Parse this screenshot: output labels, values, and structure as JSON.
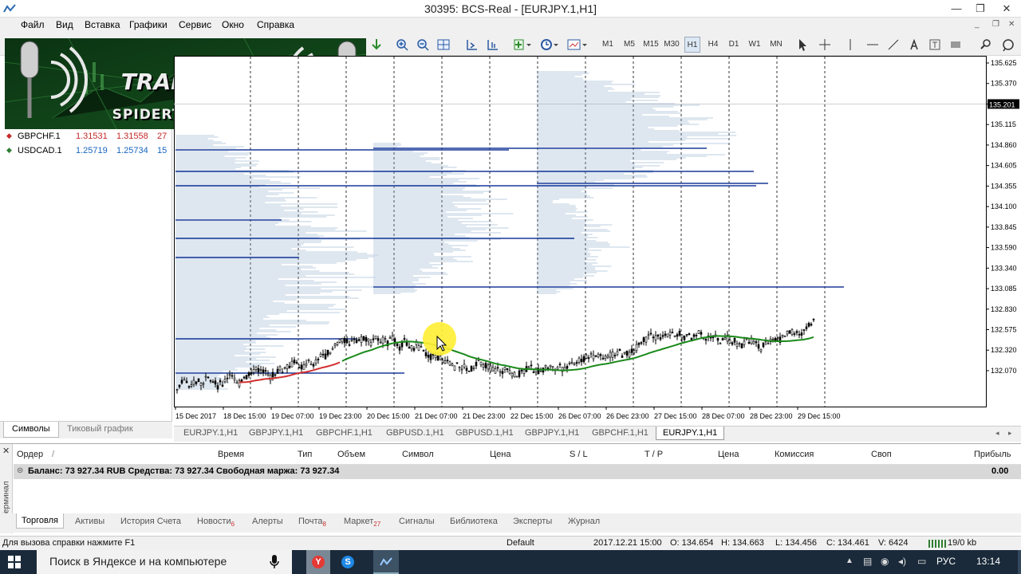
{
  "window": {
    "title": "30395: BCS-Real - [EURJPY.1,H1]"
  },
  "menu": [
    "Файл",
    "Вид",
    "Вставка",
    "Графики",
    "Сервис",
    "Окно",
    "Справка"
  ],
  "toolbar": {
    "timeframes": [
      "M1",
      "M5",
      "M15",
      "M30",
      "H1",
      "H4",
      "D1",
      "W1",
      "MN"
    ]
  },
  "banner": {
    "title": "TRADE FM",
    "subtitle": "SPIDERTC@BK.RU"
  },
  "symbols": {
    "rows": [
      {
        "name": "GBPCHF.1",
        "bid": "1.31531",
        "ask": "1.31558",
        "spread": "27",
        "dir": "down"
      },
      {
        "name": "USDCAD.1",
        "bid": "1.25719",
        "ask": "1.25734",
        "spread": "15",
        "dir": "up"
      }
    ],
    "tabs": [
      "Символы",
      "Тиковый график"
    ]
  },
  "chart": {
    "price_labels": [
      "135.625",
      "135.370",
      "135.201",
      "135.115",
      "134.860",
      "134.605",
      "134.355",
      "134.100",
      "133.845",
      "133.590",
      "133.340",
      "133.085",
      "132.830",
      "132.575",
      "132.320",
      "132.070"
    ],
    "current_price": "135.201",
    "time_labels": [
      "15 Dec 2017",
      "18 Dec 15:00",
      "19 Dec 07:00",
      "19 Dec 23:00",
      "20 Dec 15:00",
      "21 Dec 07:00",
      "21 Dec 23:00",
      "22 Dec 15:00",
      "26 Dec 07:00",
      "26 Dec 23:00",
      "27 Dec 15:00",
      "28 Dec 07:00",
      "28 Dec 23:00",
      "29 Dec 15:00"
    ]
  },
  "chart_tabs": [
    "EURJPY.1,H1",
    "GBPJPY.1,H1",
    "GBPCHF.1,H1",
    "GBPUSD.1,H1",
    "GBPUSD.1,H1",
    "GBPJPY.1,H1",
    "GBPCHF.1,H1",
    "EURJPY.1,H1"
  ],
  "terminal": {
    "headers": [
      "Ордер",
      "Время",
      "Тип",
      "Объем",
      "Символ",
      "Цена",
      "S / L",
      "T / P",
      "Цена",
      "Комиссия",
      "Своп",
      "Прибыль"
    ],
    "balance_line": "Баланс: 73 927.34 RUB  Средства: 73 927.34  Свободная маржа: 73 927.34",
    "profit": "0.00",
    "side_label": "Терминал",
    "tabs": [
      {
        "label": "Торговля",
        "badge": ""
      },
      {
        "label": "Активы",
        "badge": ""
      },
      {
        "label": "История Счета",
        "badge": ""
      },
      {
        "label": "Новости",
        "badge": "6"
      },
      {
        "label": "Алерты",
        "badge": ""
      },
      {
        "label": "Почта",
        "badge": "8"
      },
      {
        "label": "Маркет",
        "badge": "27"
      },
      {
        "label": "Сигналы",
        "badge": ""
      },
      {
        "label": "Библиотека",
        "badge": ""
      },
      {
        "label": "Эксперты",
        "badge": ""
      },
      {
        "label": "Журнал",
        "badge": ""
      }
    ]
  },
  "status": {
    "help": "Для вызова справки нажмите F1",
    "profile": "Default",
    "time": "2017.12.21 15:00",
    "open": "O: 134.654",
    "high": "H: 134.663",
    "low": "L: 134.456",
    "close": "C: 134.461",
    "volume": "V: 6424",
    "traffic": "19/0 kb"
  },
  "taskbar": {
    "search": "Поиск в Яндексе и на компьютере",
    "lang": "РУС",
    "clock": "13:14"
  }
}
